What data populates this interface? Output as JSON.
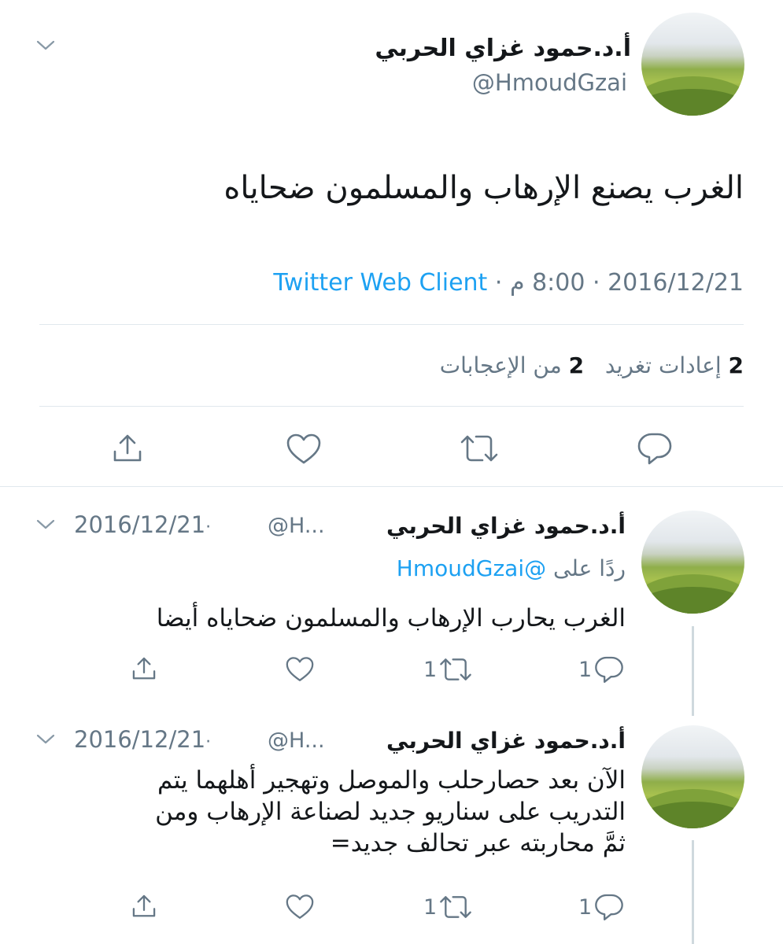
{
  "main_tweet": {
    "author_name": "أ.د.حمود غزاي الحربي",
    "handle": "@HmoudGzai",
    "text": "الغرب يصنع الإرهاب والمسلمون ضحاياه",
    "time": "8:00 م",
    "date": "2016/12/21",
    "client": "Twitter Web Client",
    "separator": "·",
    "retweets_count": "2",
    "retweets_label": "إعادات تغريد",
    "likes_count": "2",
    "likes_label": "من الإعجابات",
    "icons": [
      "reply-icon",
      "retweet-icon",
      "like-icon",
      "share-icon",
      "chevron-down-icon"
    ]
  },
  "replies": [
    {
      "author_name": "أ.د.حمود غزاي الحربي",
      "handle": "@H...",
      "date": "2016/12/21",
      "separator": "·",
      "replying_to_label": "ردًا على",
      "replying_to_handle": "@HmoudGzai",
      "text": "الغرب يحارب الإرهاب والمسلمون ضحاياه أيضا",
      "reply_count": "1",
      "retweet_count": "1"
    },
    {
      "author_name": "أ.د.حمود غزاي الحربي",
      "handle": "@H...",
      "date": "2016/12/21",
      "separator": "·",
      "text_lines": [
        "الآن بعد حصارحلب والموصل وتهجير أهلهما يتم",
        "التدريب على سناريو جديد لصناعة الإرهاب ومن",
        "ثمَّ محاربته عبر تحالف جديد="
      ],
      "reply_count": "1",
      "retweet_count": "1"
    }
  ],
  "colors": {
    "text": "#14171a",
    "secondary": "#657786",
    "accent": "#1da1f2",
    "divider": "#e1e8ed"
  }
}
